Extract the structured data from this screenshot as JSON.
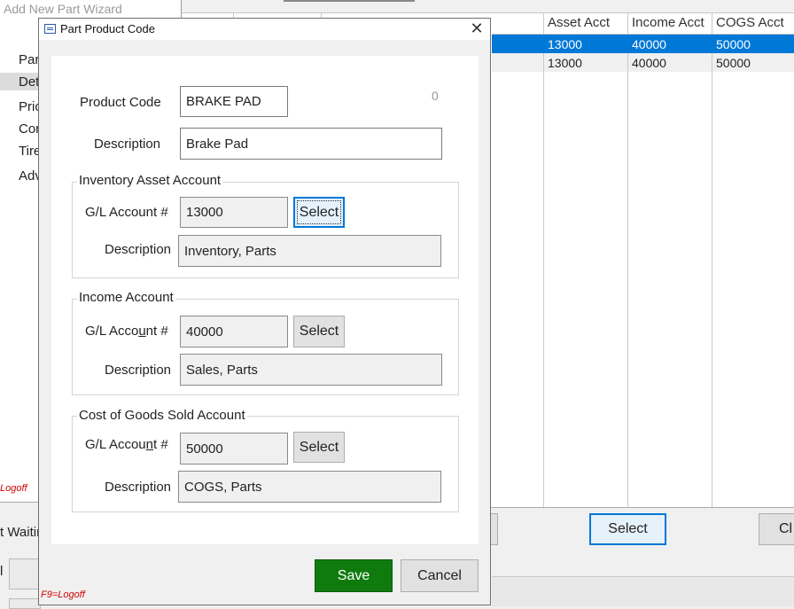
{
  "wizard": {
    "title": "Add New Part Wizard",
    "nav": [
      "Par",
      "Det",
      "Pric",
      "Cor",
      "Tire",
      "Adv"
    ],
    "logoff": "Logoff",
    "waiting": "t Waitir",
    "l_char": "l"
  },
  "grid": {
    "headers": [
      "Asset  Acct",
      "Income Acct",
      "COGS Acct"
    ],
    "rows": [
      {
        "asset": "13000",
        "income": "40000",
        "cogs": "50000",
        "selected": true
      },
      {
        "asset": "13000",
        "income": "40000",
        "cogs": "50000",
        "selected": false
      }
    ],
    "select_label": "Select",
    "close_label": "Cl"
  },
  "dialog": {
    "title": "Part Product Code",
    "close_glyph": "✕",
    "counter": "0",
    "product_code_label": "Product Code",
    "product_code": "BRAKE PAD",
    "description_label": "Description",
    "description": "Brake Pad",
    "inventory": {
      "title": "Inventory Asset Account",
      "gl_label": "G/L Account #",
      "gl_value": "13000",
      "select_label": "Select",
      "desc_label": "Description",
      "desc_value": "Inventory, Parts"
    },
    "income": {
      "title": "Income Account",
      "gl_label_pre": "G/L Acco",
      "gl_label_ul": "u",
      "gl_label_post": "nt #",
      "gl_value": "40000",
      "select_label": "Select",
      "desc_label": "Description",
      "desc_value": "Sales, Parts"
    },
    "cogs": {
      "title": "Cost of Goods Sold Account",
      "gl_label_pre": "G/L Accou",
      "gl_label_ul": "n",
      "gl_label_post": "t #",
      "gl_value": "50000",
      "select_label": "Select",
      "desc_label": "Description",
      "desc_value": "COGS, Parts"
    },
    "save_label": "Save",
    "cancel_label": "Cancel",
    "f9_logoff": "F9=Logoff"
  },
  "colors": {
    "selection": "#0078d7",
    "save_green": "#0f7b0f",
    "logoff_red": "#d10000"
  }
}
